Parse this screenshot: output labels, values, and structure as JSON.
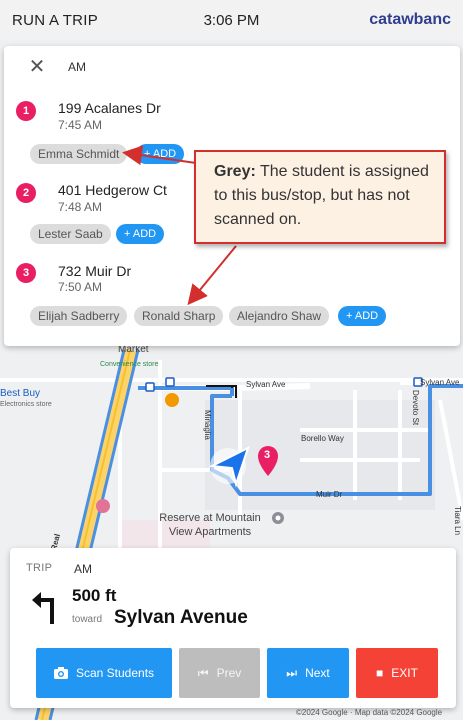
{
  "header": {
    "title": "RUN A TRIP",
    "time": "3:06 PM",
    "brand": "catawbanc"
  },
  "stops_panel": {
    "period": "AM",
    "stops": [
      {
        "number": "1",
        "address": "199 Acalanes Dr",
        "time": "7:45 AM",
        "students": [
          "Emma Schmidt"
        ],
        "add_label": "+ ADD"
      },
      {
        "number": "2",
        "address": "401 Hedgerow Ct",
        "time": "7:48 AM",
        "students": [
          "Lester Saab"
        ],
        "add_label": "+ ADD"
      },
      {
        "number": "3",
        "address": "732 Muir Dr",
        "time": "7:50 AM",
        "students": [
          "Elijah Sadberry",
          "Ronald Sharp",
          "Alejandro Shaw"
        ],
        "add_label": "+ ADD"
      }
    ]
  },
  "callout": {
    "bold": "Grey:",
    "text": " The student is assigned to this bus/stop, but has not scanned on."
  },
  "map": {
    "labels": {
      "market": "Market",
      "convenience": "Convenience store",
      "best_buy": "Best Buy",
      "best_buy_sub": "Electronics store",
      "sylvan_ave": "Sylvan Ave",
      "sylvan_ave_right": "Sylvan Ave",
      "borello_way": "Borello Way",
      "muir_dr": "Muir Dr",
      "minaglia": "Minaglia",
      "devoto_st": "Devoto St",
      "camino_real": "mino Real",
      "tiara_ln": "Tiara Ln",
      "reserve": "Reserve at Mountain View Apartments"
    },
    "stop_marker": "3",
    "colors": {
      "route": "#4a90e2",
      "stop": "#e91e63"
    }
  },
  "navigation": {
    "trip_label": "TRIP",
    "trip_value": "AM",
    "distance": "500 ft",
    "toward_label": "toward",
    "toward_value": "Sylvan Avenue",
    "turn": "left-turn-icon"
  },
  "buttons": {
    "scan": "Scan Students",
    "prev": "Prev",
    "next": "Next",
    "exit": "EXIT"
  },
  "attribution": "©2024 Google · Map data ©2024 Google"
}
